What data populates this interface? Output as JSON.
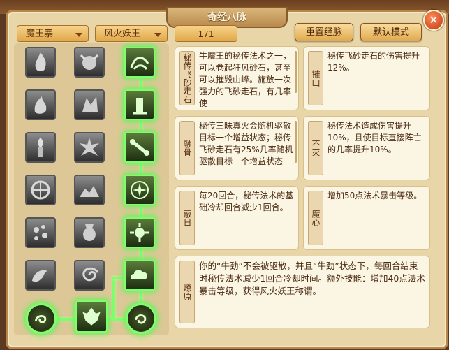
{
  "window": {
    "title": "奇经八脉",
    "close_label": "✕"
  },
  "toolbar": {
    "sect_dropdown": "魔王寨",
    "title_dropdown": "风火妖王",
    "points_value": "171",
    "reset_label": "重置经脉",
    "default_label": "默认模式"
  },
  "skill_icons": [
    {
      "name": "flame-skill-icon"
    },
    {
      "name": "beast-skill-icon"
    },
    {
      "name": "wind-skill-icon"
    },
    {
      "name": "fire-hand-icon"
    },
    {
      "name": "monster-skill-icon"
    },
    {
      "name": "tower-skill-icon"
    },
    {
      "name": "torch-skill-icon"
    },
    {
      "name": "burst-skill-icon"
    },
    {
      "name": "bone-skill-icon"
    },
    {
      "name": "compass-skill-icon"
    },
    {
      "name": "rock-skill-icon"
    },
    {
      "name": "star-skill-icon"
    },
    {
      "name": "dots-skill-icon"
    },
    {
      "name": "vase-skill-icon"
    },
    {
      "name": "sun-skill-icon"
    },
    {
      "name": "dragon-skill-icon"
    },
    {
      "name": "swirl-skill-icon"
    },
    {
      "name": "cloud-skill-icon"
    },
    {
      "name": "orb-left-icon"
    },
    {
      "name": "demon-skill-icon"
    },
    {
      "name": "orb-right-icon"
    }
  ],
  "cards": [
    {
      "tag": "秘传飞砂走石",
      "desc": "牛魔王的秘传法术之一，可以卷起狂风砂石，甚至可以摧毁山峰。施放一次强力的飞砂走石，有几率使"
    },
    {
      "tag": "摧山",
      "desc": "秘传飞砂走石的伤害提升12%。"
    },
    {
      "tag": "融骨",
      "desc": "秘传三昧真火会随机驱散目标一个增益状态；秘传飞砂走石有25%几率随机驱散目标一个增益状态"
    },
    {
      "tag": "不灭",
      "desc": "秘传法术造成伤害提升10%，且使目标直接阵亡的几率提升10%。"
    },
    {
      "tag": "蔽日",
      "desc": "每20回合，秘传法术的基础冷却回合减少1回合。"
    },
    {
      "tag": "魔心",
      "desc": "增加50点法术暴击等级。"
    },
    {
      "tag": "燎原",
      "desc": "你的“牛劲”不会被驱散，并且“牛劲”状态下，每回合结束时秘传法术减少1回合冷却时间。额外技能：增加40点法术暴击等级，获得风火妖王称谓。"
    }
  ],
  "colors": {
    "active_glow": "#7dff6b",
    "panel": "#e9d6a8",
    "button": "#e2aa50"
  }
}
